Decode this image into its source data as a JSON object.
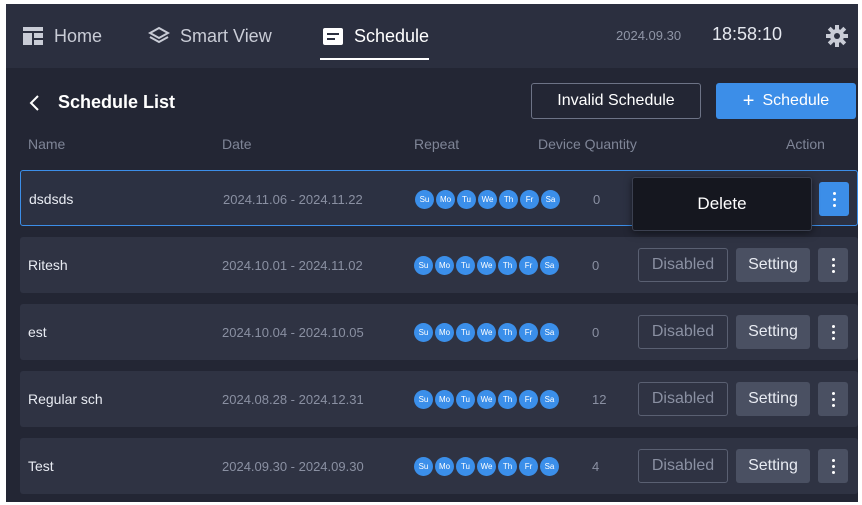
{
  "nav": {
    "home": {
      "label": "Home",
      "icon": "home-grid-icon"
    },
    "smart_view": {
      "label": "Smart View",
      "icon": "layers-icon"
    },
    "schedule": {
      "label": "Schedule",
      "icon": "schedule-icon"
    }
  },
  "status": {
    "date": "2024.09.30",
    "time": "18:58:10"
  },
  "header": {
    "title": "Schedule List",
    "invalid_button": "Invalid Schedule",
    "add_button": "Schedule",
    "add_icon": "+"
  },
  "columns": {
    "name": "Name",
    "date": "Date",
    "repeat": "Repeat",
    "quantity": "Device Quantity",
    "action": "Action"
  },
  "days": [
    "Su",
    "Mo",
    "Tu",
    "We",
    "Th",
    "Fr",
    "Sa"
  ],
  "rows": [
    {
      "name": "dsdsds",
      "date": "2024.11.06 - 2024.11.22",
      "quantity": "0",
      "status": "",
      "setting": ""
    },
    {
      "name": "Ritesh",
      "date": "2024.10.01 - 2024.11.02",
      "quantity": "0",
      "status": "Disabled",
      "setting": "Setting"
    },
    {
      "name": "est",
      "date": "2024.10.04 - 2024.10.05",
      "quantity": "0",
      "status": "Disabled",
      "setting": "Setting"
    },
    {
      "name": "Regular sch",
      "date": "2024.08.28 - 2024.12.31",
      "quantity": "12",
      "status": "Disabled",
      "setting": "Setting"
    },
    {
      "name": "Test",
      "date": "2024.09.30 - 2024.09.30",
      "quantity": "4",
      "status": "Disabled",
      "setting": "Setting"
    }
  ],
  "popup": {
    "delete_label": "Delete"
  },
  "colors": {
    "accent": "#3c8ee8",
    "background": "#232634",
    "row": "#2f3343"
  }
}
